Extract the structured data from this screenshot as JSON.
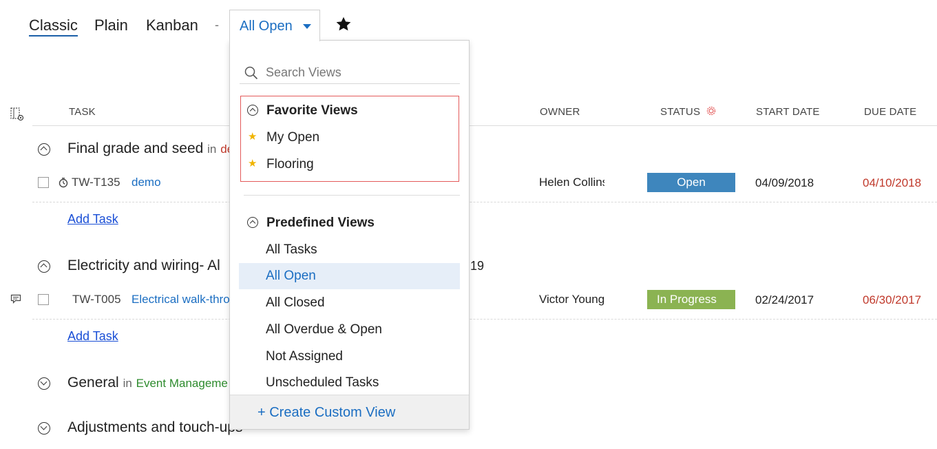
{
  "tabs": [
    "Classic",
    "Plain",
    "Kanban"
  ],
  "separator": "-",
  "view_select": {
    "label": "All Open"
  },
  "columns": {
    "task": "TASK",
    "owner": "OWNER",
    "status": "STATUS",
    "start_date": "START DATE",
    "due_date": "DUE DATE"
  },
  "groups": [
    {
      "title": "Final grade and seed",
      "in_label": "in",
      "project": "de",
      "tasks": [
        {
          "id": "TW-T135",
          "name": "demo",
          "owner": "Helen Collins",
          "status": "Open",
          "start": "04/09/2018",
          "due": "04/10/2018"
        }
      ],
      "add_task": "Add Task"
    },
    {
      "title": "Electricity and wiring- Al",
      "title_tail": "19",
      "tasks": [
        {
          "id": "TW-T005",
          "name": "Electrical walk-thro",
          "owner": "Victor Young",
          "status": "In Progress",
          "start": "02/24/2017",
          "due": "06/30/2017"
        }
      ],
      "add_task": "Add Task"
    },
    {
      "title": "General",
      "in_label": "in",
      "project": "Event Manageme"
    },
    {
      "title": "Adjustments and touch-ups"
    }
  ],
  "dropdown": {
    "search_placeholder": "Search Views",
    "favorite_title": "Favorite Views",
    "favorites": [
      "My Open",
      "Flooring"
    ],
    "predefined_title": "Predefined Views",
    "predefined": [
      "All Tasks",
      "All Open",
      "All Closed",
      "All Overdue & Open",
      "Not Assigned",
      "Unscheduled Tasks"
    ],
    "selected": "All Open",
    "create_label": "+ Create Custom View"
  },
  "colors": {
    "accent": "#1b6ec2",
    "open": "#3e86bd",
    "in_progress": "#8bb352",
    "overdue": "#c0392b",
    "favorite_star": "#f0b400",
    "highlight_border": "#e35a5a"
  }
}
